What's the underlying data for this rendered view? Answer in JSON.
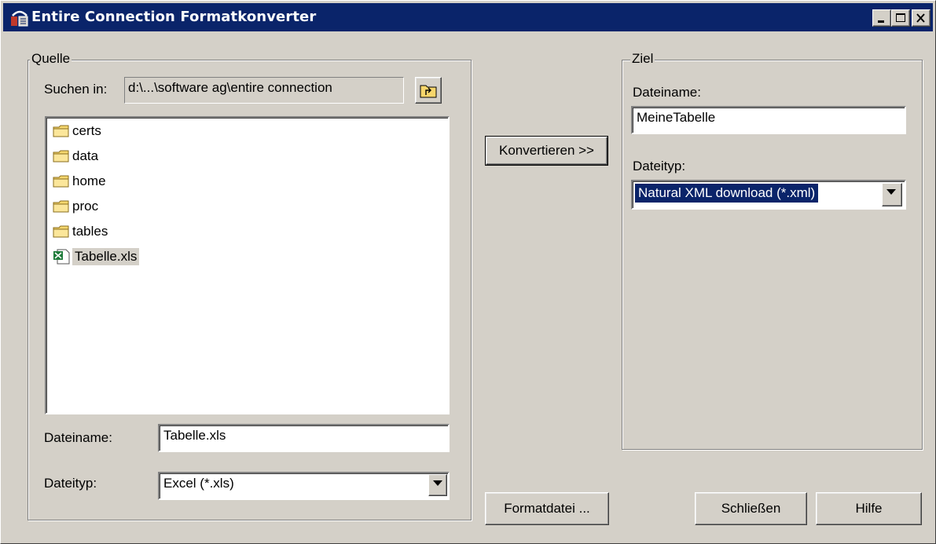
{
  "window": {
    "title": "Entire Connection Formatkonverter"
  },
  "source": {
    "group_label": "Quelle",
    "search_in_label": "Suchen in:",
    "search_in_path": "d:\\...\\software ag\\entire connection",
    "files": [
      {
        "name": "certs",
        "icon": "folder-icon"
      },
      {
        "name": "data",
        "icon": "folder-icon"
      },
      {
        "name": "home",
        "icon": "folder-icon"
      },
      {
        "name": "proc",
        "icon": "folder-icon"
      },
      {
        "name": "tables",
        "icon": "folder-icon"
      },
      {
        "name": "Tabelle.xls",
        "icon": "excel-file-icon",
        "selected": true
      }
    ],
    "filename_label": "Dateiname:",
    "filename_value": "Tabelle.xls",
    "filetype_label": "Dateityp:",
    "filetype_value": "Excel (*.xls)"
  },
  "convert_button": "Konvertieren >>",
  "format_button": "Formatdatei ...",
  "target": {
    "group_label": "Ziel",
    "filename_label": "Dateiname:",
    "filename_value": "MeineTabelle",
    "filetype_label": "Dateityp:",
    "filetype_value": "Natural XML download (*.xml)"
  },
  "close_button": "Schließen",
  "help_button": "Hilfe",
  "colors": {
    "titlebar": "#0a246a",
    "face": "#d4d0c8",
    "selection": "#0a246a"
  }
}
